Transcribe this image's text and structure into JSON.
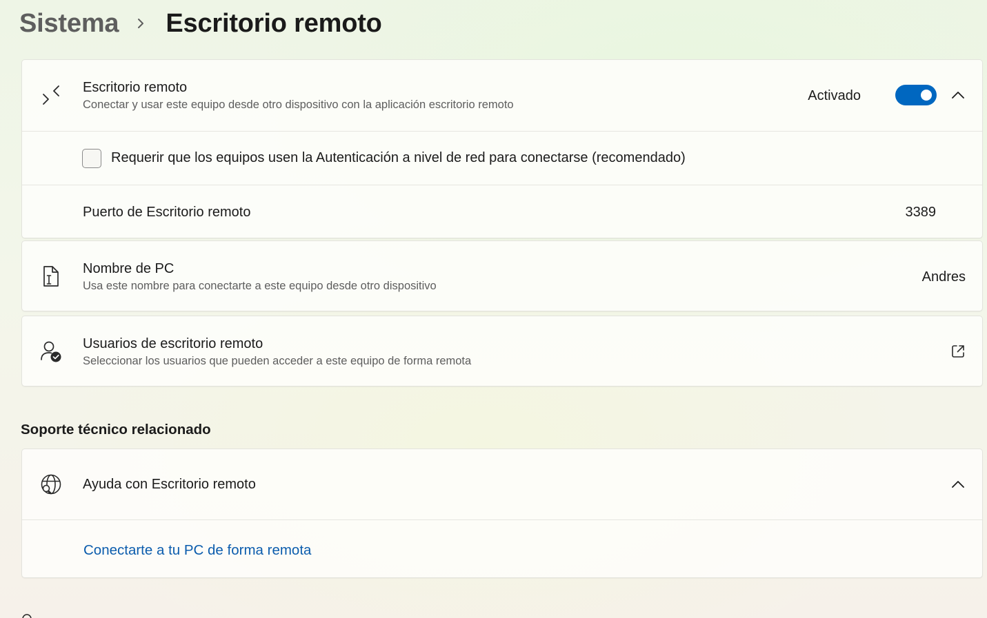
{
  "breadcrumb": {
    "parent": "Sistema",
    "current": "Escritorio remoto"
  },
  "remote_desktop": {
    "title": "Escritorio remoto",
    "subtitle": "Conectar y usar este equipo desde otro dispositivo con la aplicación escritorio remoto",
    "status_label": "Activado",
    "enabled": true,
    "nla_checkbox_label": "Requerir que los equipos usen la Autenticación a nivel de red para conectarse (recomendado)",
    "nla_checked": false,
    "port_label": "Puerto de Escritorio remoto",
    "port_value": "3389"
  },
  "pc_name": {
    "title": "Nombre de PC",
    "subtitle": "Usa este nombre para conectarte a este equipo desde otro dispositivo",
    "value": "Andres"
  },
  "users": {
    "title": "Usuarios de escritorio remoto",
    "subtitle": "Seleccionar los usuarios que pueden acceder a este equipo de forma remota"
  },
  "support": {
    "section_title": "Soporte técnico relacionado",
    "help_title": "Ayuda con Escritorio remoto",
    "link_label": "Conectarte a tu PC de forma remota"
  },
  "colors": {
    "accent": "#0067c0",
    "link": "#0b5cad"
  }
}
